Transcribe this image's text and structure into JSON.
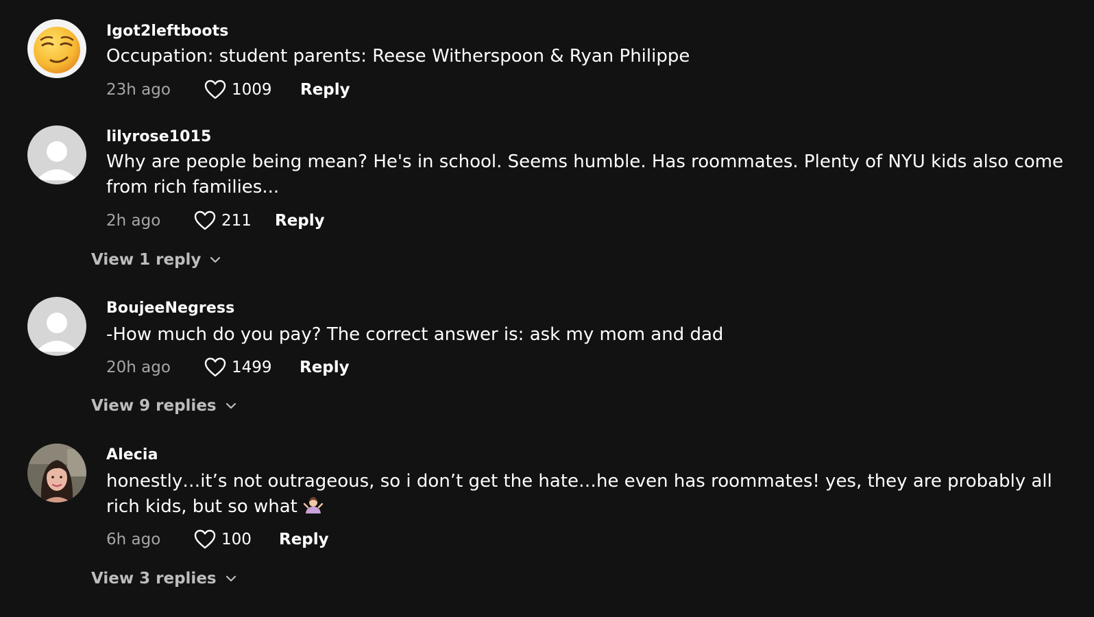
{
  "colors": {
    "background": "#121212",
    "text_primary": "#ffffff",
    "text_secondary": "#a6a6a6",
    "view_replies": "#bdbdbd"
  },
  "comments": [
    {
      "username": "Igot2leftboots",
      "avatar_icon": "smirking-face-emoji",
      "text": "Occupation: student parents: Reese Witherspoon & Ryan Philippe",
      "time": "23h ago",
      "likes": "1009",
      "reply_label": "Reply"
    },
    {
      "username": "lilyrose1015",
      "avatar_icon": "default-user-avatar",
      "text": "Why are people being mean? He's in school. Seems humble. Has roommates. Plenty of NYU kids also come from rich families...",
      "time": "2h ago",
      "likes": "211",
      "reply_label": "Reply",
      "view_replies": "View 1 reply"
    },
    {
      "username": "BoujeeNegress",
      "avatar_icon": "default-user-avatar",
      "text": "-How much do you pay? The correct answer is: ask my mom and dad",
      "time": "20h ago",
      "likes": "1499",
      "reply_label": "Reply",
      "view_replies": "View 9 replies"
    },
    {
      "username": "Alecia",
      "avatar_icon": "profile-photo",
      "text": "honestly…it’s not outrageous, so i don’t get the hate…he even has roommates! yes, they are probably all rich kids, but so what",
      "text_emoji": "shrugging-person-emoji",
      "time": "6h ago",
      "likes": "100",
      "reply_label": "Reply",
      "view_replies": "View 3 replies"
    }
  ]
}
